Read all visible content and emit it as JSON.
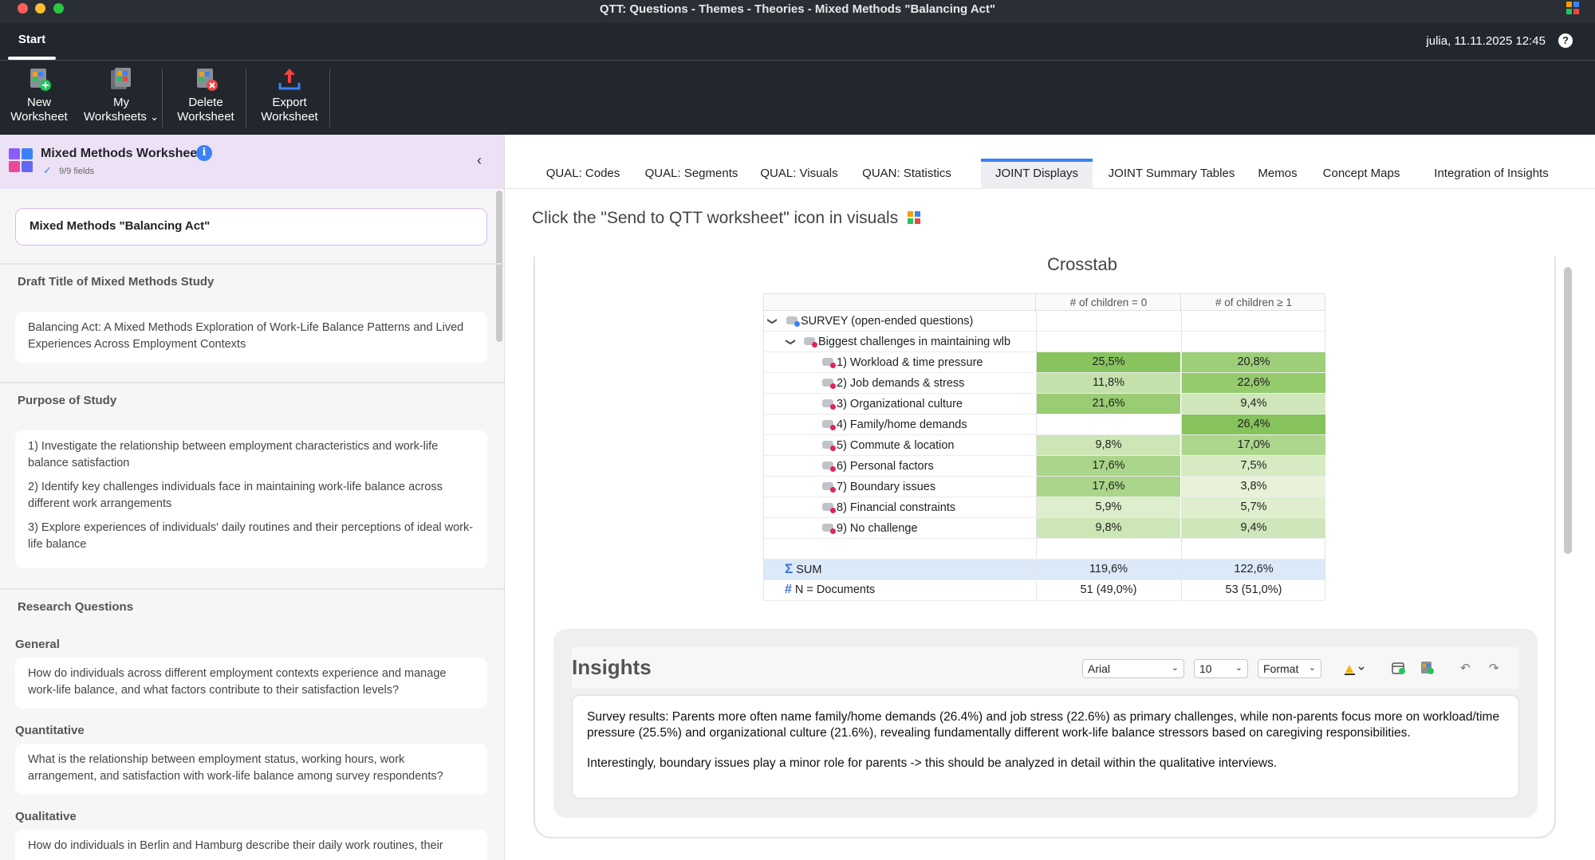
{
  "window": {
    "title": "QTT: Questions - Themes - Theories - Mixed Methods \"Balancing Act\""
  },
  "tabstrip": {
    "start_tab": "Start",
    "user_info": "julia,  11.11.2025 12:45",
    "help": "?"
  },
  "ribbon": {
    "buttons": [
      {
        "line1": "New",
        "line2": "Worksheet"
      },
      {
        "line1": "My",
        "line2": "Worksheets",
        "dropdown": "⌄"
      },
      {
        "line1": "Delete",
        "line2": "Worksheet"
      },
      {
        "line1": "Export",
        "line2": "Worksheet"
      }
    ]
  },
  "left_panel": {
    "header_title": "Mixed Methods Worksheet",
    "info": "i",
    "check": "✓",
    "fields_status": "9/9 fields",
    "collapse": "‹",
    "worksheet_name": "Mixed Methods \"Balancing Act\"",
    "draft_title_label": "Draft Title of Mixed Methods Study",
    "draft_title": "Balancing Act: A Mixed Methods Exploration of Work-Life Balance Patterns and Lived Experiences Across Employment Contexts",
    "purpose_label": "Purpose of Study",
    "purpose": [
      "1) Investigate the relationship between employment characteristics and work-life balance satisfaction",
      "2) Identify key challenges individuals face in maintaining work-life balance across different work arrangements",
      "3) Explore experiences of individuals' daily routines and their perceptions of ideal work-life balance"
    ],
    "rq_label": "Research Questions",
    "general_label": "General",
    "general_q": "How do individuals across different employment contexts experience and manage work-life balance, and what factors contribute to their satisfaction levels?",
    "quant_label": "Quantitative",
    "quant_q": "What is the relationship between employment status, working hours, work arrangement, and satisfaction with work-life balance among survey respondents?",
    "qual_label": "Qualitative",
    "qual_q": "How do individuals in Berlin and Hamburg describe their daily work routines, their"
  },
  "tabs": [
    "QUAL: Codes",
    "QUAL: Segments",
    "QUAL: Visuals",
    "QUAN: Statistics",
    "JOINT Displays",
    "JOINT Summary Tables",
    "Memos",
    "Concept Maps",
    "Integration of Insights"
  ],
  "active_tab": "JOINT Displays",
  "hint": "Click the \"Send to QTT worksheet\" icon in visuals",
  "crosstab": {
    "title": "Crosstab",
    "col1": "# of children = 0",
    "col2": "# of children ≥ 1",
    "root": "SURVEY (open-ended questions)",
    "group": "Biggest challenges in maintaining wlb",
    "rows": [
      {
        "label": "1) Workload & time pressure",
        "v1": "25,5%",
        "v2": "20,8%",
        "p1": 25.5,
        "p2": 20.8
      },
      {
        "label": "2) Job demands & stress",
        "v1": "11,8%",
        "v2": "22,6%",
        "p1": 11.8,
        "p2": 22.6
      },
      {
        "label": "3) Organizational culture",
        "v1": "21,6%",
        "v2": "9,4%",
        "p1": 21.6,
        "p2": 9.4
      },
      {
        "label": "4) Family/home demands",
        "v1": "",
        "v2": "26,4%",
        "p1": 0,
        "p2": 26.4
      },
      {
        "label": "5) Commute & location",
        "v1": "9,8%",
        "v2": "17,0%",
        "p1": 9.8,
        "p2": 17.0
      },
      {
        "label": "6) Personal factors",
        "v1": "17,6%",
        "v2": "7,5%",
        "p1": 17.6,
        "p2": 7.5
      },
      {
        "label": "7) Boundary issues",
        "v1": "17,6%",
        "v2": "3,8%",
        "p1": 17.6,
        "p2": 3.8
      },
      {
        "label": "8) Financial constraints",
        "v1": "5,9%",
        "v2": "5,7%",
        "p1": 5.9,
        "p2": 5.7
      },
      {
        "label": "9) No challenge",
        "v1": "9,8%",
        "v2": "9,4%",
        "p1": 9.8,
        "p2": 9.4
      }
    ],
    "sum_label": "SUM",
    "sum_v1": "119,6%",
    "sum_v2": "122,6%",
    "n_label": "N = Documents",
    "n_v1": "51 (49,0%)",
    "n_v2": "53 (51,0%)",
    "sum_icon": "Σ",
    "n_icon": "#"
  },
  "insights": {
    "title": "Insights",
    "font": "Arial",
    "size": "10",
    "format": "Format",
    "paragraph1": "Survey results: Parents more often name family/home demands (26.4%) and job stress (22.6%) as primary challenges, while non-parents focus more on workload/time pressure (25.5%) and organizational culture (21.6%), revealing fundamentally different work-life balance stressors based on caregiving responsibilities.",
    "paragraph2": "Interestingly, boundary issues play a minor role for parents -> this should be analyzed in detail within the qualitative interviews."
  },
  "colors": {
    "heat_high": "#86c35a",
    "heat_low": "#eaf4dd",
    "accent": "#3b82f6"
  }
}
